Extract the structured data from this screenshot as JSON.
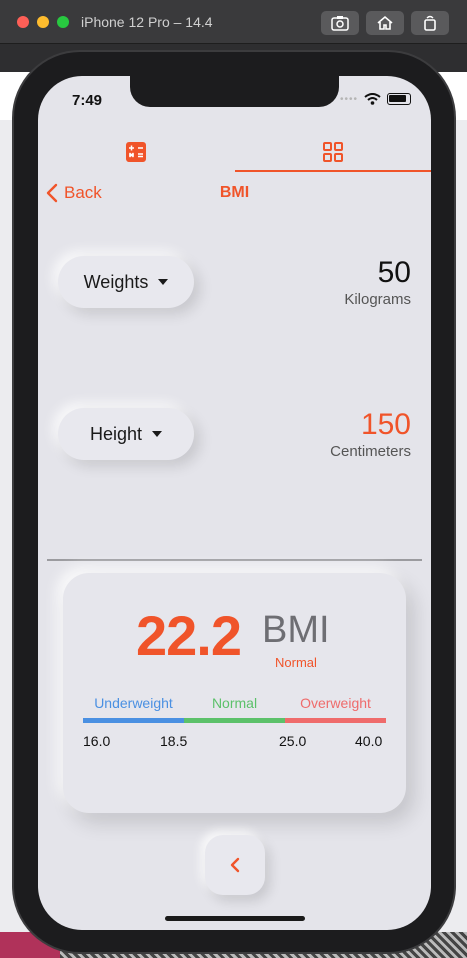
{
  "window": {
    "title": "iPhone 12 Pro – 14.4",
    "buttons": [
      "screenshot-icon",
      "home-icon",
      "rotate-icon"
    ]
  },
  "status_bar": {
    "time": "7:49"
  },
  "tabs": [
    {
      "icon": "calculator-icon",
      "selected": false
    },
    {
      "icon": "grid-icon",
      "selected": true
    }
  ],
  "nav": {
    "back_label": "Back",
    "title": "BMI"
  },
  "weight": {
    "selector_label": "Weights",
    "value": "50",
    "unit": "Kilograms"
  },
  "height": {
    "selector_label": "Height",
    "value": "150",
    "unit": "Centimeters"
  },
  "result": {
    "bmi": "22.2",
    "label": "BMI",
    "category": "Normal",
    "ranges": [
      "Underweight",
      "Normal",
      "Overweight"
    ],
    "ticks": [
      "16.0",
      "18.5",
      "25.0",
      "40.0"
    ]
  },
  "colors": {
    "accent": "#f0542a",
    "underweight": "#4a90e2",
    "normal": "#5cc16a",
    "overweight": "#ef6b6b"
  }
}
